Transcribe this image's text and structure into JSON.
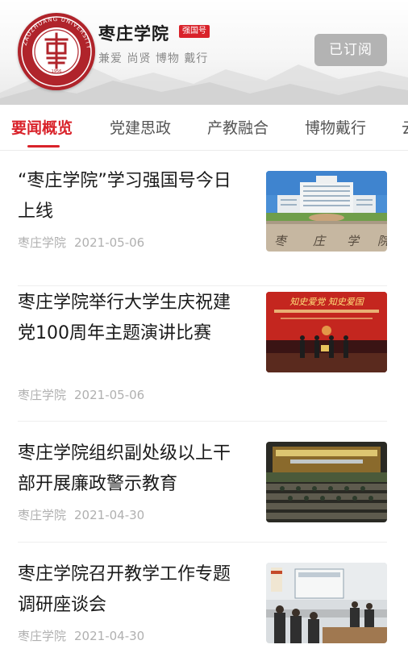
{
  "account": {
    "name": "枣庄学院",
    "badge": "强国号",
    "tagline": "兼爱 尚贤 博物 戴行",
    "subscribe_label": "已订阅",
    "logo_text": "ZAOZHUANG UNIVERSITY",
    "logo_year": "1956"
  },
  "tabs": [
    {
      "label": "要闻概览",
      "active": true
    },
    {
      "label": "党建思政",
      "active": false
    },
    {
      "label": "产教融合",
      "active": false
    },
    {
      "label": "博物戴行",
      "active": false
    },
    {
      "label": "云",
      "active": false
    }
  ],
  "articles": [
    {
      "title": "“枣庄学院”学习强国号今日上线",
      "source": "枣庄学院",
      "date": "2021-05-06"
    },
    {
      "title": "枣庄学院举行大学生庆祝建党100周年主题演讲比赛",
      "source": "枣庄学院",
      "date": "2021-05-06",
      "thumb_banner": "知史爱党  知史爱国"
    },
    {
      "title": "枣庄学院组织副处级以上干部开展廉政警示教育",
      "source": "枣庄学院",
      "date": "2021-04-30"
    },
    {
      "title": "枣庄学院召开教学工作专题调研座谈会",
      "source": "枣庄学院",
      "date": "2021-04-30"
    }
  ],
  "colors": {
    "accent": "#d9222a",
    "logo": "#b0242b",
    "subscribed_button": "#b3b3b3",
    "meta_text": "#b0b0b0"
  }
}
